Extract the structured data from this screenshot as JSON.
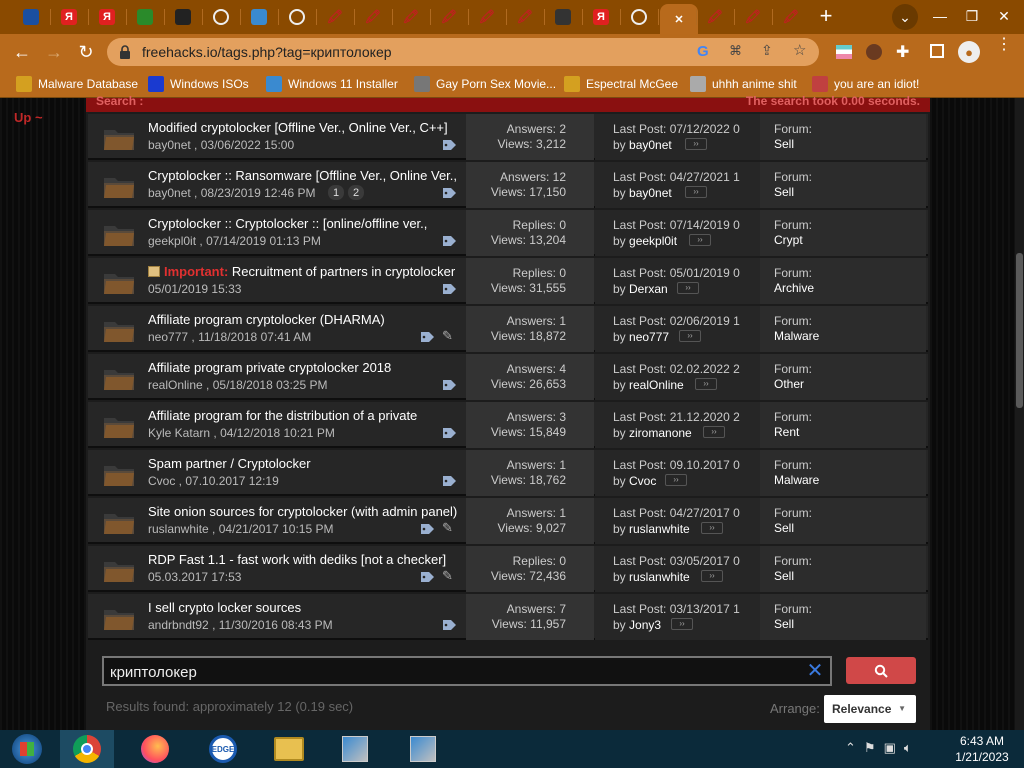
{
  "browser": {
    "tabs": [
      {
        "icon": "blue-cube-icon",
        "color": "#1a4fa0"
      },
      {
        "icon": "yandex-icon",
        "color": "#e02020",
        "glyph": "Я"
      },
      {
        "icon": "yandex-icon",
        "color": "#e02020",
        "glyph": "Я"
      },
      {
        "icon": "flask-icon",
        "color": "#2a8a2a"
      },
      {
        "icon": "x-logo-icon",
        "color": "#222"
      },
      {
        "icon": "globe-icon",
        "color": "#ddd"
      },
      {
        "icon": "hash-icon",
        "color": "#3a8ad0"
      },
      {
        "icon": "globe-icon",
        "color": "#ddd"
      },
      {
        "icon": "red-pin-icon",
        "color": "#c02020"
      },
      {
        "icon": "red-pin-icon",
        "color": "#c02020"
      },
      {
        "icon": "red-pin-icon",
        "color": "#c02020"
      },
      {
        "icon": "red-pin-icon",
        "color": "#c02020"
      },
      {
        "icon": "red-pin-icon",
        "color": "#c02020"
      },
      {
        "icon": "red-pin-icon",
        "color": "#c02020"
      },
      {
        "icon": "terminal-icon",
        "color": "#333"
      },
      {
        "icon": "yandex-icon",
        "color": "#e02020",
        "glyph": "Я"
      },
      {
        "icon": "globe-icon",
        "color": "#ddd"
      },
      {
        "icon": "active-tab-icon",
        "color": "#fff"
      },
      {
        "icon": "red-pin-icon",
        "color": "#c02020"
      },
      {
        "icon": "red-pin-icon",
        "color": "#c02020"
      },
      {
        "icon": "red-pin-icon",
        "color": "#c02020"
      }
    ],
    "url": "freehacks.io/tags.php?tag=криптолокер",
    "bookmarks": [
      {
        "label": "Malware Database",
        "color": "#d4a020"
      },
      {
        "label": "Windows ISOs",
        "color": "#1a3ad0"
      },
      {
        "label": "Windows 11 Installer",
        "color": "#3a8ad0"
      },
      {
        "label": "Gay Porn Sex Movie...",
        "color": "#777"
      },
      {
        "label": "Espectral McGee",
        "color": "#d4a020"
      },
      {
        "label": "uhhh anime shit",
        "color": "#aaa"
      },
      {
        "label": "you are an idiot!",
        "color": "#c04040"
      }
    ]
  },
  "page": {
    "up_label": "Up ~",
    "header_left": "Search :",
    "header_right": "The search took 0.00 seconds.",
    "threads": [
      {
        "title": "Modified cryptolocker [Offline Ver., Online Ver., C++]",
        "important": "",
        "author": "bay0net",
        "date": "03/06/2022 15:00",
        "stat1": "Answers: 2",
        "stat2": "Views: 3,212",
        "last_post": "Last Post: 07/12/2022 0",
        "last_by": "bay0net",
        "forum_label": "Forum:",
        "forum": "Sell",
        "tags": true,
        "clip": false,
        "pages": []
      },
      {
        "title": "Cryptolocker :: Ransomware [Offline Ver., Online Ver.,",
        "important": "",
        "author": "bay0net",
        "date": "08/23/2019 12:46 PM",
        "stat1": "Answers: 12",
        "stat2": "Views: 17,150",
        "last_post": "Last Post: 04/27/2021 1",
        "last_by": "bay0net",
        "forum_label": "Forum:",
        "forum": "Sell",
        "tags": true,
        "clip": false,
        "pages": [
          "1",
          "2"
        ]
      },
      {
        "title": "Cryptolocker :: Cryptolocker :: [online/offline ver.,",
        "important": "",
        "author": "geekpl0it",
        "date": "07/14/2019 01:13 PM",
        "stat1": "Replies: 0",
        "stat2": "Views: 13,204",
        "last_post": "Last Post: 07/14/2019 0",
        "last_by": "geekpl0it",
        "forum_label": "Forum:",
        "forum": "Crypt",
        "tags": true,
        "clip": false,
        "pages": []
      },
      {
        "title": "Recruitment of partners in cryptolocker",
        "important": "Important:",
        "author": "",
        "date": "05/01/2019 15:33",
        "stat1": "Replies: 0",
        "stat2": "Views: 31,555",
        "last_post": "Last Post: 05/01/2019 0",
        "last_by": "Derxan",
        "forum_label": "Forum:",
        "forum": "Archive",
        "tags": true,
        "clip": false,
        "pages": []
      },
      {
        "title": "Affiliate program cryptolocker (DHARMA)",
        "important": "",
        "author": "neo777",
        "date": "11/18/2018 07:41 AM",
        "stat1": "Answers: 1",
        "stat2": "Views: 18,872",
        "last_post": "Last Post: 02/06/2019 1",
        "last_by": "neo777",
        "forum_label": "Forum:",
        "forum": "Malware",
        "tags": true,
        "clip": true,
        "pages": []
      },
      {
        "title": "Affiliate program private cryptolocker 2018",
        "important": "",
        "author": "realOnline",
        "date": "05/18/2018 03:25 PM",
        "stat1": "Answers: 4",
        "stat2": "Views: 26,653",
        "last_post": "Last Post: 02.02.2022 2",
        "last_by": "realOnline",
        "forum_label": "Forum:",
        "forum": "Other",
        "tags": true,
        "clip": false,
        "pages": []
      },
      {
        "title": "Affiliate program for the distribution of a private",
        "important": "",
        "author": "Kyle Katarn",
        "date": "04/12/2018 10:21 PM",
        "stat1": "Answers: 3",
        "stat2": "Views: 15,849",
        "last_post": "Last Post: 21.12.2020 2",
        "last_by": "ziromanone",
        "forum_label": "Forum:",
        "forum": "Rent",
        "tags": true,
        "clip": false,
        "pages": []
      },
      {
        "title": "Spam partner / Cryptolocker",
        "important": "",
        "author": "Cvoc",
        "date": "07.10.2017 12:19",
        "stat1": "Answers: 1",
        "stat2": "Views: 18,762",
        "last_post": "Last Post: 09.10.2017 0",
        "last_by": "Cvoc",
        "forum_label": "Forum:",
        "forum": "Malware",
        "tags": true,
        "clip": false,
        "pages": []
      },
      {
        "title": "Site onion sources for cryptolocker (with admin panel)",
        "important": "",
        "author": "ruslanwhite",
        "date": "04/21/2017 10:15 PM",
        "stat1": "Answers: 1",
        "stat2": "Views: 9,027",
        "last_post": "Last Post: 04/27/2017 0",
        "last_by": "ruslanwhite",
        "forum_label": "Forum:",
        "forum": "Sell",
        "tags": true,
        "clip": true,
        "pages": []
      },
      {
        "title": "RDP Fast 1.1 - fast work with dediks [not a checker]",
        "important": "",
        "author": "",
        "date": "05.03.2017 17:53",
        "stat1": "Replies: 0",
        "stat2": "Views: 72,436",
        "last_post": "Last Post: 03/05/2017 0",
        "last_by": "ruslanwhite",
        "forum_label": "Forum:",
        "forum": "Sell",
        "tags": true,
        "clip": true,
        "pages": []
      },
      {
        "title": "I sell crypto locker sources",
        "important": "",
        "author": "andrbndt92",
        "date": "11/30/2016 08:43 PM",
        "stat1": "Answers: 7",
        "stat2": "Views: 11,957",
        "last_post": "Last Post: 03/13/2017 1",
        "last_by": "Jony3",
        "forum_label": "Forum:",
        "forum": "Sell",
        "tags": true,
        "clip": false,
        "pages": []
      }
    ],
    "search": {
      "value": "криптолокер",
      "results_text": "Results found: approximately 12 (0.19 sec)",
      "arrange_label": "Arrange:",
      "arrange_value": "Relevance"
    }
  },
  "taskbar": {
    "apps": [
      "start-orb-icon",
      "chrome-icon",
      "firefox-icon",
      "edge-icon",
      "file-explorer-icon",
      "installer-icon",
      "installer-icon"
    ],
    "time": "6:43 AM",
    "date": "1/21/2023"
  }
}
